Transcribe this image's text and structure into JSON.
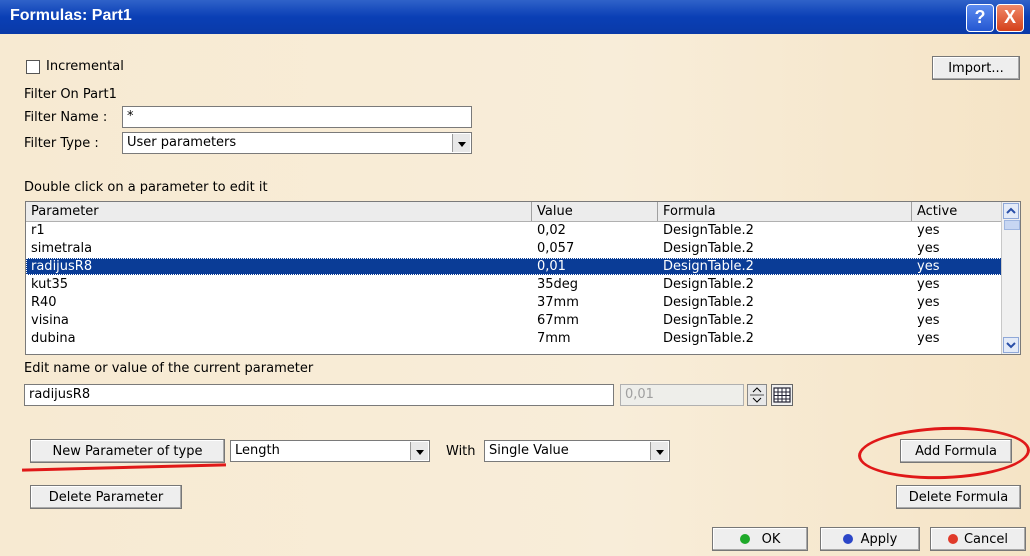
{
  "window": {
    "title": "Formulas: Part1",
    "help_glyph": "?",
    "close_glyph": "X"
  },
  "options": {
    "incremental_label": "Incremental",
    "incremental_checked": false,
    "import_label": "Import..."
  },
  "filter": {
    "on_label": "Filter On Part1",
    "name_label": "Filter Name :",
    "name_value": "*",
    "type_label": "Filter Type :",
    "type_value": "User parameters"
  },
  "table": {
    "hint": "Double click on a parameter to edit it",
    "columns": [
      "Parameter",
      "Value",
      "Formula",
      "Active"
    ],
    "rows": [
      {
        "parameter": "r1",
        "value": "0,02",
        "formula": "DesignTable.2",
        "active": "yes"
      },
      {
        "parameter": "simetrala",
        "value": "0,057",
        "formula": "DesignTable.2",
        "active": "yes"
      },
      {
        "parameter": "radijusR8",
        "value": "0,01",
        "formula": "DesignTable.2",
        "active": "yes",
        "selected": true
      },
      {
        "parameter": "kut35",
        "value": "35deg",
        "formula": "DesignTable.2",
        "active": "yes"
      },
      {
        "parameter": "R40",
        "value": "37mm",
        "formula": "DesignTable.2",
        "active": "yes"
      },
      {
        "parameter": "visina",
        "value": "67mm",
        "formula": "DesignTable.2",
        "active": "yes"
      },
      {
        "parameter": "dubina",
        "value": "7mm",
        "formula": "DesignTable.2",
        "active": "yes"
      }
    ]
  },
  "edit": {
    "label": "Edit name or value of the current parameter",
    "name_value": "radijusR8",
    "value_value": "0,01"
  },
  "new_param": {
    "button_label": "New Parameter of type",
    "type_value": "Length",
    "with_label": "With",
    "with_value": "Single Value",
    "add_formula_label": "Add Formula",
    "delete_parameter_label": "Delete Parameter",
    "delete_formula_label": "Delete Formula"
  },
  "footer": {
    "ok_label": "OK",
    "apply_label": "Apply",
    "cancel_label": "Cancel"
  },
  "colors": {
    "title_bar": "#0a3fb5",
    "selection": "#0a3c96",
    "annotation": "#e01818",
    "ok_dot": "#1faa2a",
    "apply_dot": "#2b46c8",
    "cancel_dot": "#e03a2a"
  }
}
